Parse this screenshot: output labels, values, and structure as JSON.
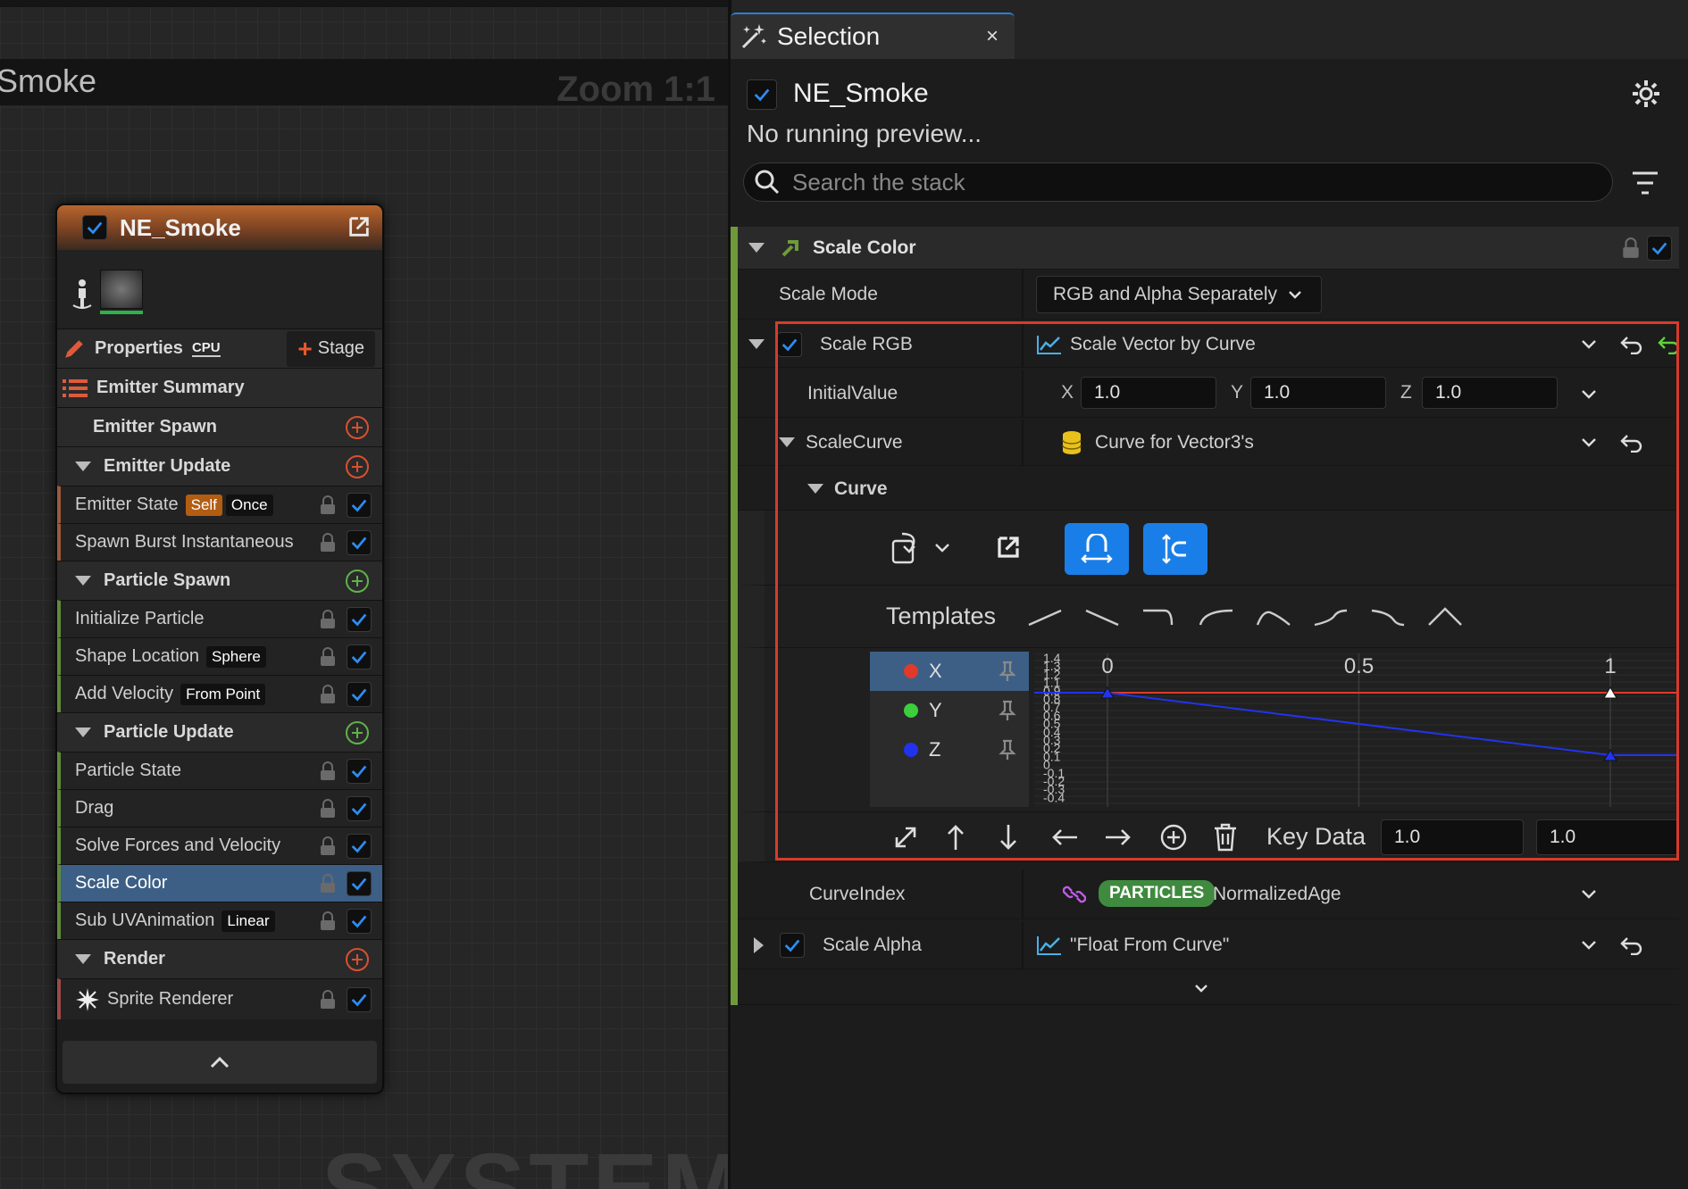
{
  "graph": {
    "title": "Smoke",
    "zoom": "Zoom 1:1",
    "watermark": "SYSTEM"
  },
  "node": {
    "title": "NE_Smoke",
    "properties_label": "Properties",
    "cpu_label": "CPU",
    "stage_label": "Stage",
    "summary_label": "Emitter Summary",
    "sections": {
      "emitter_spawn": "Emitter Spawn",
      "emitter_update": "Emitter Update",
      "particle_spawn": "Particle Spawn",
      "particle_update": "Particle Update",
      "render": "Render"
    },
    "items": {
      "emitter_state": "Emitter State",
      "emitter_state_tag1": "Self",
      "emitter_state_tag2": "Once",
      "spawn_burst": "Spawn Burst Instantaneous",
      "initialize_particle": "Initialize Particle",
      "shape_location": "Shape Location",
      "shape_location_tag": "Sphere",
      "add_velocity": "Add Velocity",
      "add_velocity_tag": "From Point",
      "particle_state": "Particle State",
      "drag": "Drag",
      "solve_forces": "Solve Forces and Velocity",
      "scale_color": "Scale Color",
      "sub_uv": "Sub UVAnimation",
      "sub_uv_tag": "Linear",
      "sprite_renderer": "Sprite Renderer"
    }
  },
  "panel": {
    "tab_title": "Selection",
    "tab_close": "×",
    "root_name": "NE_Smoke",
    "preview_text": "No running preview...",
    "search_placeholder": "Search the stack",
    "module_title": "Scale Color",
    "scale_mode_label": "Scale Mode",
    "scale_mode_value": "RGB and Alpha Separately",
    "scale_rgb_label": "Scale RGB",
    "scale_rgb_value": "Scale Vector by Curve",
    "initial_value_label": "InitialValue",
    "x_label": "X",
    "x_value": "1.0",
    "y_label": "Y",
    "y_value": "1.0",
    "z_label": "Z",
    "z_value": "1.0",
    "scale_curve_label": "ScaleCurve",
    "scale_curve_value": "Curve for Vector3's",
    "curve_label": "Curve",
    "templates_label": "Templates",
    "curve_channels": [
      "X",
      "Y",
      "Z"
    ],
    "curve_axis_top": [
      "0",
      "0.5",
      "1"
    ],
    "curve_axis_left": [
      "1.4",
      "1.3",
      "1.2",
      "1.1",
      "0.9",
      "0.8",
      "0.7",
      "0.6",
      "0.5",
      "0.4",
      "0.3",
      "0.2",
      "0.1",
      "0",
      "-0.1",
      "-0.2",
      "-0.3",
      "-0.4"
    ],
    "key_data_label": "Key Data",
    "key_data_time": "1.0",
    "key_data_value": "1.0",
    "curve_index_label": "CurveIndex",
    "curve_index_badge": "PARTICLES",
    "curve_index_value": "NormalizedAge",
    "scale_alpha_label": "Scale Alpha",
    "scale_alpha_value": "\"Float From Curve\""
  },
  "colors": {
    "accent_blue": "#1a7ee8",
    "curve_x": "#e03a2b",
    "curve_y": "#3bcf3b",
    "curve_z": "#2233ee",
    "selection_box": "#d93a2b",
    "stack_bar": "#6f9a3a",
    "particles_badge": "#3f8a3f"
  }
}
